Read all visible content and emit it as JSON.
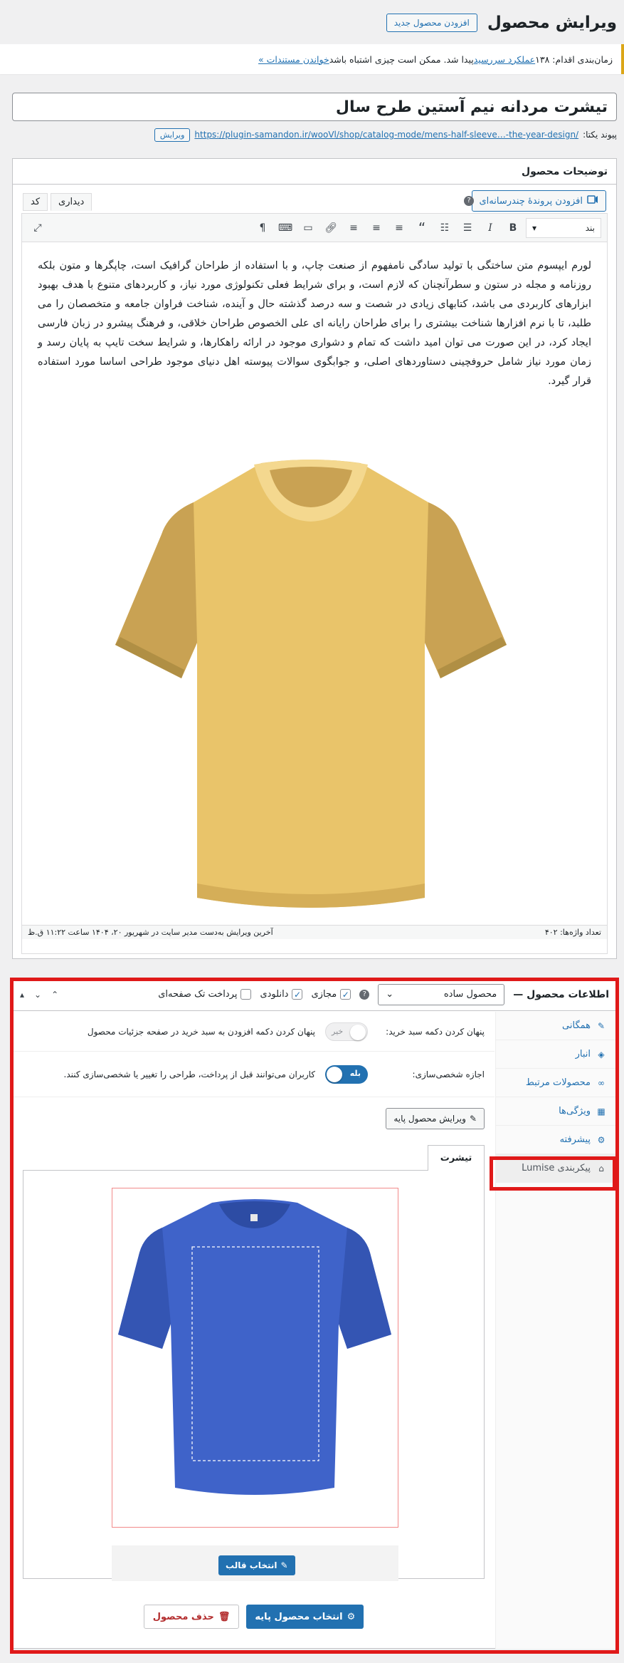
{
  "header": {
    "title": "ویرایش محصول",
    "add_new_label": "افزودن محصول جدید"
  },
  "notice": {
    "prefix": "زمان‌بندی اقدام: ۱۳۸ ",
    "link1": "عملکرد سررسید",
    "middle": " پیدا شد. ممکن است چیزی اشتباه باشد ",
    "link2": "خواندن مستندات »"
  },
  "product": {
    "title": "تیشرت مردانه نیم آستین طرح سال",
    "permalink_label": "پیوند یکتا:",
    "permalink_url": "https://plugin-samandon.ir/wooVl/shop/catalog-mode/mens-half-sleeve…-the-year-design/",
    "permalink_edit": "ویرایش"
  },
  "description": {
    "box_title": "توضیحات محصول",
    "add_media_label": "افزودن پروندهٔ چندرسانه‌ای",
    "tab_visual": "دیداری",
    "tab_code": "کد",
    "format_select": "بند",
    "body_text": "لورم ایپسوم متن ساختگی با تولید سادگی نامفهوم از صنعت چاپ، و با استفاده از طراحان گرافیک است، چاپگرها و متون بلکه روزنامه و مجله در ستون و سطرآنچنان که لازم است، و برای شرایط فعلی تکنولوژی مورد نیاز، و کاربردهای متنوع با هدف بهبود ابزارهای کاربردی می باشد، کتابهای زیادی در شصت و سه درصد گذشته حال و آینده، شناخت فراوان جامعه و متخصصان را می طلبد، تا با نرم افزارها شناخت بیشتری را برای طراحان رایانه ای علی الخصوص طراحان خلاقی، و فرهنگ پیشرو در زبان فارسی ایجاد کرد، در این صورت می توان امید داشت که تمام و دشواری موجود در ارائه راهکارها، و شرایط سخت تایپ به پایان رسد و زمان مورد نیاز شامل حروفچینی دستاوردهای اصلی، و جوابگوی سوالات پیوسته اهل دنیای موجود طراحی اساسا مورد استفاده قرار گیرد.",
    "word_count": "تعداد واژه‌ها: ۴۰۲",
    "last_edit": "آخرین ویرایش به‌دست مدیر سایت در شهریور ۲۰، ۱۴۰۴ ساعت ۱۱:۲۲ ق.ظ"
  },
  "product_data": {
    "label": "اطلاعات محصول —",
    "type_value": "محصول ساده",
    "virtual_label": "مجازی",
    "downloadable_label": "دانلودی",
    "single_page_label": "پرداخت تک صفحه‌ای",
    "tabs": [
      {
        "label": "همگانی",
        "icon": "wrench-icon"
      },
      {
        "label": "انبار",
        "icon": "tag-icon"
      },
      {
        "label": "محصولات مرتبط",
        "icon": "link-icon"
      },
      {
        "label": "ویژگی‌ها",
        "icon": "table-icon"
      },
      {
        "label": "پیشرفته",
        "icon": "gear-icon"
      },
      {
        "label": "پیکربندی Lumise",
        "icon": "store-icon"
      }
    ],
    "hide_cart_label": "پنهان کردن دکمه سبد خرید:",
    "hide_cart_toggle": "خیر",
    "hide_cart_desc": "پنهان کردن دکمه افزودن به سبد خرید در صفحه جزئیات محصول",
    "allow_custom_label": "اجازه شخصی‌سازی:",
    "allow_custom_toggle": "بله",
    "allow_custom_desc": "کاربران می‌توانند قبل از پرداخت، طراحی را تغییر یا شخصی‌سازی کنند.",
    "edit_base_label": "ویرایش محصول پایه",
    "stage_tab": "تیشرت",
    "choose_template_label": "انتخاب قالب",
    "choose_base_label": "انتخاب محصول پایه",
    "delete_label": "حذف محصول"
  },
  "colors": {
    "accent": "#2271b1",
    "highlight": "#e01919",
    "shirt_yellow": "#e9c46a",
    "shirt_blue": "#3f63c9"
  }
}
